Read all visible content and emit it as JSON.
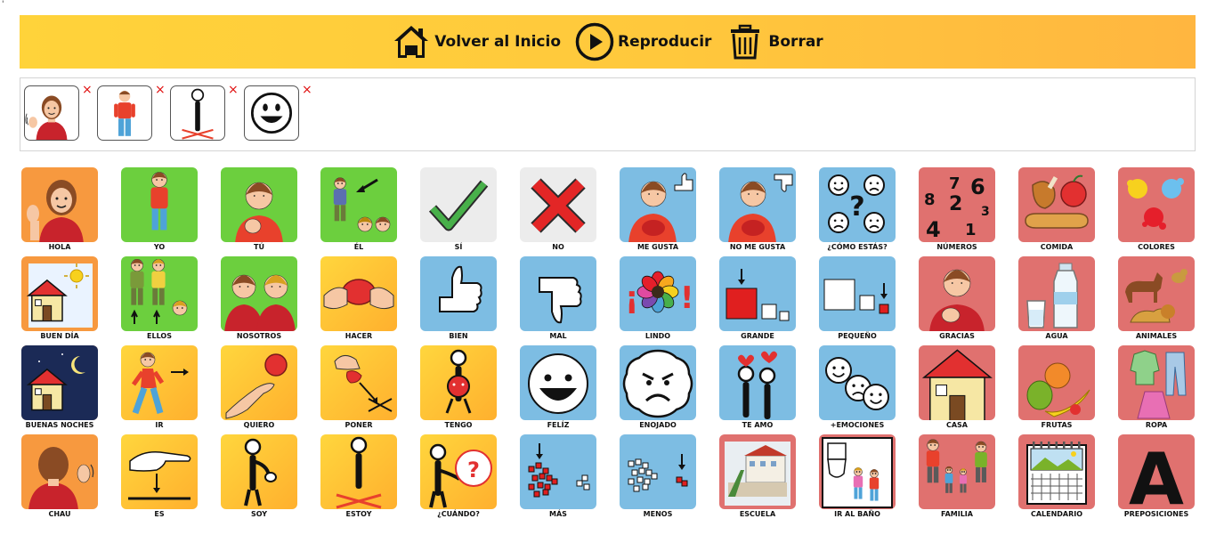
{
  "corner_mark": "'",
  "toolbar": {
    "home_label": "Volver al Inicio",
    "play_label": "Reproducir",
    "clear_label": "Borrar"
  },
  "sentence": {
    "remove_symbol": "×",
    "items": [
      "hola",
      "yo",
      "estoy",
      "feliz"
    ]
  },
  "colors": {
    "toolbar_start": "#ffd33a",
    "toolbar_end": "#ffb640",
    "orange": "#f7993f",
    "green": "#6ccf3e",
    "grey": "#ececec",
    "blue": "#7dbde3",
    "red": "#e0716f",
    "yellow": "#ffc83c"
  },
  "cards": [
    {
      "label": "HOLA",
      "bg": "orange",
      "icon": "person-wave"
    },
    {
      "label": "YO",
      "bg": "green",
      "icon": "boy-standing"
    },
    {
      "label": "TÚ",
      "bg": "green",
      "icon": "boy-pointing"
    },
    {
      "label": "ÉL",
      "bg": "green",
      "icon": "him-arrow"
    },
    {
      "label": "SÍ",
      "bg": "grey",
      "icon": "check"
    },
    {
      "label": "NO",
      "bg": "grey",
      "icon": "cross"
    },
    {
      "label": "ME GUSTA",
      "bg": "blue",
      "icon": "thumb-up-boy"
    },
    {
      "label": "NO ME GUSTA",
      "bg": "blue",
      "icon": "thumb-down-boy"
    },
    {
      "label": "¿CÓMO ESTÁS?",
      "bg": "blue",
      "icon": "faces-question"
    },
    {
      "label": "NÚMEROS",
      "bg": "red",
      "icon": "numbers"
    },
    {
      "label": "COMIDA",
      "bg": "red",
      "icon": "food"
    },
    {
      "label": "COLORES",
      "bg": "red",
      "icon": "paint-splashes"
    },
    {
      "label": "BUEN DÍA",
      "bg": "orange",
      "icon": "house-sun"
    },
    {
      "label": "ELLOS",
      "bg": "green",
      "icon": "they"
    },
    {
      "label": "NOSOTROS",
      "bg": "green",
      "icon": "we"
    },
    {
      "label": "HACER",
      "bg": "yellow",
      "icon": "hands-make"
    },
    {
      "label": "BIEN",
      "bg": "blue",
      "icon": "thumb-up"
    },
    {
      "label": "MAL",
      "bg": "blue",
      "icon": "thumb-down"
    },
    {
      "label": "LINDO",
      "bg": "blue",
      "icon": "flower"
    },
    {
      "label": "GRANDE",
      "bg": "blue",
      "icon": "big-square"
    },
    {
      "label": "PEQUEÑO",
      "bg": "blue",
      "icon": "small-square"
    },
    {
      "label": "GRACIAS",
      "bg": "red",
      "icon": "thanks"
    },
    {
      "label": "AGUA",
      "bg": "red",
      "icon": "water"
    },
    {
      "label": "ANIMALES",
      "bg": "red",
      "icon": "animals"
    },
    {
      "label": "BUENAS NOCHES",
      "bg": "orange",
      "icon": "house-moon"
    },
    {
      "label": "IR",
      "bg": "yellow",
      "icon": "walking"
    },
    {
      "label": "QUIERO",
      "bg": "yellow",
      "icon": "want"
    },
    {
      "label": "PONER",
      "bg": "yellow",
      "icon": "put"
    },
    {
      "label": "TENGO",
      "bg": "yellow",
      "icon": "have"
    },
    {
      "label": "FELÍZ",
      "bg": "blue",
      "icon": "happy-face"
    },
    {
      "label": "ENOJADO",
      "bg": "blue",
      "icon": "angry-face"
    },
    {
      "label": "TE AMO",
      "bg": "blue",
      "icon": "love"
    },
    {
      "label": "+EMOCIONES",
      "bg": "blue",
      "icon": "more-emotions"
    },
    {
      "label": "CASA",
      "bg": "red",
      "icon": "house"
    },
    {
      "label": "FRUTAS",
      "bg": "red",
      "icon": "fruits"
    },
    {
      "label": "ROPA",
      "bg": "red",
      "icon": "clothes"
    },
    {
      "label": "CHAU",
      "bg": "orange",
      "icon": "bye"
    },
    {
      "label": "ES",
      "bg": "yellow",
      "icon": "is"
    },
    {
      "label": "SOY",
      "bg": "yellow",
      "icon": "i-am"
    },
    {
      "label": "ESTOY",
      "bg": "yellow",
      "icon": "stick-standing"
    },
    {
      "label": "¿CUÁNDO?",
      "bg": "yellow",
      "icon": "when-clock"
    },
    {
      "label": "MÁS",
      "bg": "blue",
      "icon": "more"
    },
    {
      "label": "MENOS",
      "bg": "blue",
      "icon": "less"
    },
    {
      "label": "ESCUELA",
      "bg": "red",
      "icon": "school"
    },
    {
      "label": "IR AL BAÑO",
      "bg": "red",
      "icon": "bathroom"
    },
    {
      "label": "FAMILIA",
      "bg": "red",
      "icon": "family"
    },
    {
      "label": "CALENDARIO",
      "bg": "red",
      "icon": "calendar"
    },
    {
      "label": "PREPOSICIONES",
      "bg": "red",
      "icon": "letter-a"
    }
  ]
}
